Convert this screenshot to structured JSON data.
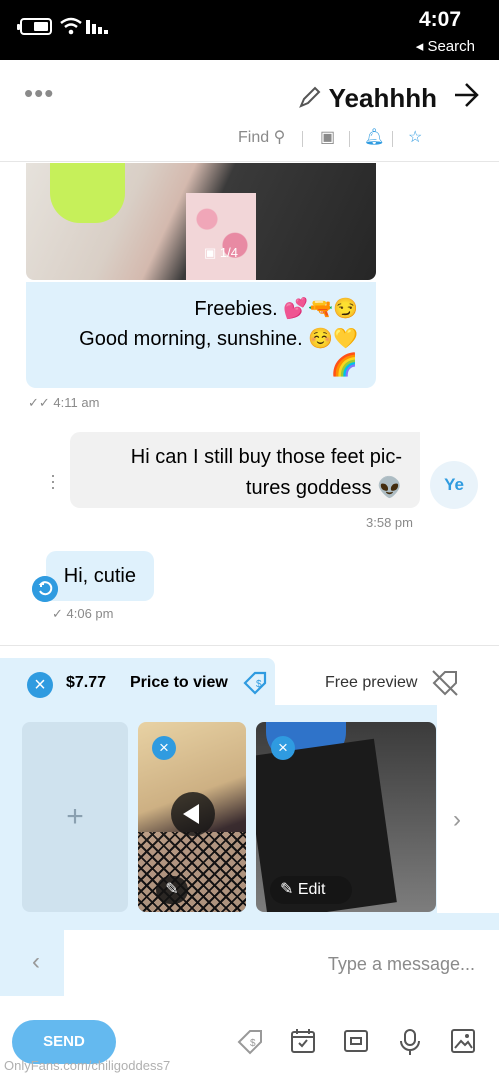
{
  "status_bar": {
    "time": "4:07",
    "back_label": "◂ Search"
  },
  "header": {
    "name": "Yeahhhh",
    "find_label": "Find"
  },
  "messages": {
    "photo_counter": "1/4",
    "incoming_1": {
      "line1": "Freebies. 💕🔫😏",
      "line2": "Good morning, sunshine. ☺️💛",
      "line3": "🌈",
      "time": "4:11 am"
    },
    "outgoing_1": {
      "line1": "Hi can I still buy those feet pic-",
      "line2": "tures goddess 👽",
      "time": "3:58 pm"
    },
    "avatar_initials": "Ye",
    "incoming_2": {
      "text": "Hi, cutie",
      "time": "4:06 pm"
    }
  },
  "composer": {
    "price_value": "$7.77",
    "price_label": "Price to view",
    "free_label": "Free preview",
    "add_symbol": "+",
    "edit_label": "Edit",
    "placeholder": "Type a message...",
    "send_label": "SEND"
  },
  "watermark": "OnlyFans.com/chiligoddess7",
  "colors": {
    "accent": "#2f9be0",
    "bubble_in": "#dff1fc",
    "bubble_out": "#f1f1f1",
    "send": "#64b9ef"
  }
}
